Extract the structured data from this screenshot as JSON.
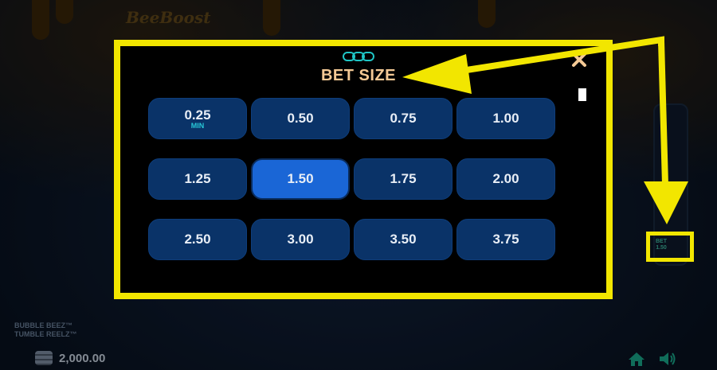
{
  "game": {
    "logo_text": "BeeBoost",
    "bottom_title_line1": "BUBBLE BEEZ™",
    "bottom_title_line2": "TUMBLE REELZ™",
    "balance": "2,000.00"
  },
  "modal": {
    "title": "BET SIZE",
    "selected_value": "1.50",
    "options": [
      {
        "label": "0.25",
        "sub": "MIN"
      },
      {
        "label": "0.50",
        "sub": ""
      },
      {
        "label": "0.75",
        "sub": ""
      },
      {
        "label": "1.00",
        "sub": ""
      },
      {
        "label": "1.25",
        "sub": ""
      },
      {
        "label": "1.50",
        "sub": ""
      },
      {
        "label": "1.75",
        "sub": ""
      },
      {
        "label": "2.00",
        "sub": ""
      },
      {
        "label": "2.50",
        "sub": ""
      },
      {
        "label": "3.00",
        "sub": ""
      },
      {
        "label": "3.50",
        "sub": ""
      },
      {
        "label": "3.75",
        "sub": ""
      }
    ]
  },
  "side_button": {
    "label_line1": "BET",
    "label_line2": "1.50"
  },
  "colors": {
    "annotation": "#f2e600",
    "selected": "#1a66d6",
    "button": "#0a3368"
  }
}
